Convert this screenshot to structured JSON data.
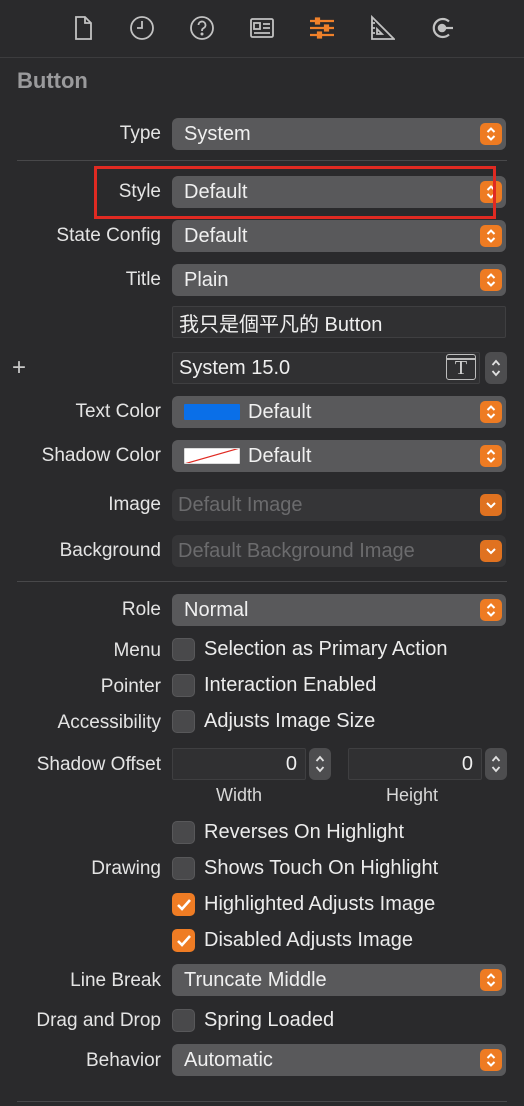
{
  "toolbar": {
    "icons": [
      "file-icon",
      "history-icon",
      "help-icon",
      "identity-icon",
      "attributes-icon",
      "size-icon",
      "connections-icon"
    ],
    "active": "attributes-icon",
    "accent": "#f0812a"
  },
  "section": {
    "title": "Button"
  },
  "fields": {
    "type": {
      "label": "Type",
      "value": "System"
    },
    "style": {
      "label": "Style",
      "value": "Default"
    },
    "state_config": {
      "label": "State Config",
      "value": "Default"
    },
    "title": {
      "label": "Title",
      "value": "Plain"
    },
    "title_text": {
      "value": "我只是個平凡的 Button"
    },
    "font": {
      "value": "System 15.0",
      "button_glyph": "T"
    },
    "text_color": {
      "label": "Text Color",
      "value": "Default",
      "swatch": "#0a6fe8"
    },
    "shadow_color": {
      "label": "Shadow Color",
      "value": "Default"
    },
    "image": {
      "label": "Image",
      "placeholder": "Default Image"
    },
    "background": {
      "label": "Background",
      "placeholder": "Default Background Image"
    },
    "role": {
      "label": "Role",
      "value": "Normal"
    },
    "menu": {
      "label": "Menu",
      "checkbox": "Selection as Primary Action",
      "checked": false
    },
    "pointer": {
      "label": "Pointer",
      "checkbox": "Interaction Enabled",
      "checked": false
    },
    "accessibility": {
      "label": "Accessibility",
      "checkbox": "Adjusts Image Size",
      "checked": false
    },
    "shadow_offset": {
      "label": "Shadow Offset",
      "width": "0",
      "height": "0",
      "width_label": "Width",
      "height_label": "Height"
    },
    "drawing": {
      "label": "Drawing",
      "options": [
        {
          "text": "Reverses On Highlight",
          "checked": false
        },
        {
          "text": "Shows Touch On Highlight",
          "checked": false
        },
        {
          "text": "Highlighted Adjusts Image",
          "checked": true
        },
        {
          "text": "Disabled Adjusts Image",
          "checked": true
        }
      ]
    },
    "line_break": {
      "label": "Line Break",
      "value": "Truncate Middle"
    },
    "drag_and_drop": {
      "label": "Drag and Drop",
      "checkbox": "Spring Loaded",
      "checked": false
    },
    "behavior": {
      "label": "Behavior",
      "value": "Automatic"
    }
  },
  "plus_glyph": "+"
}
